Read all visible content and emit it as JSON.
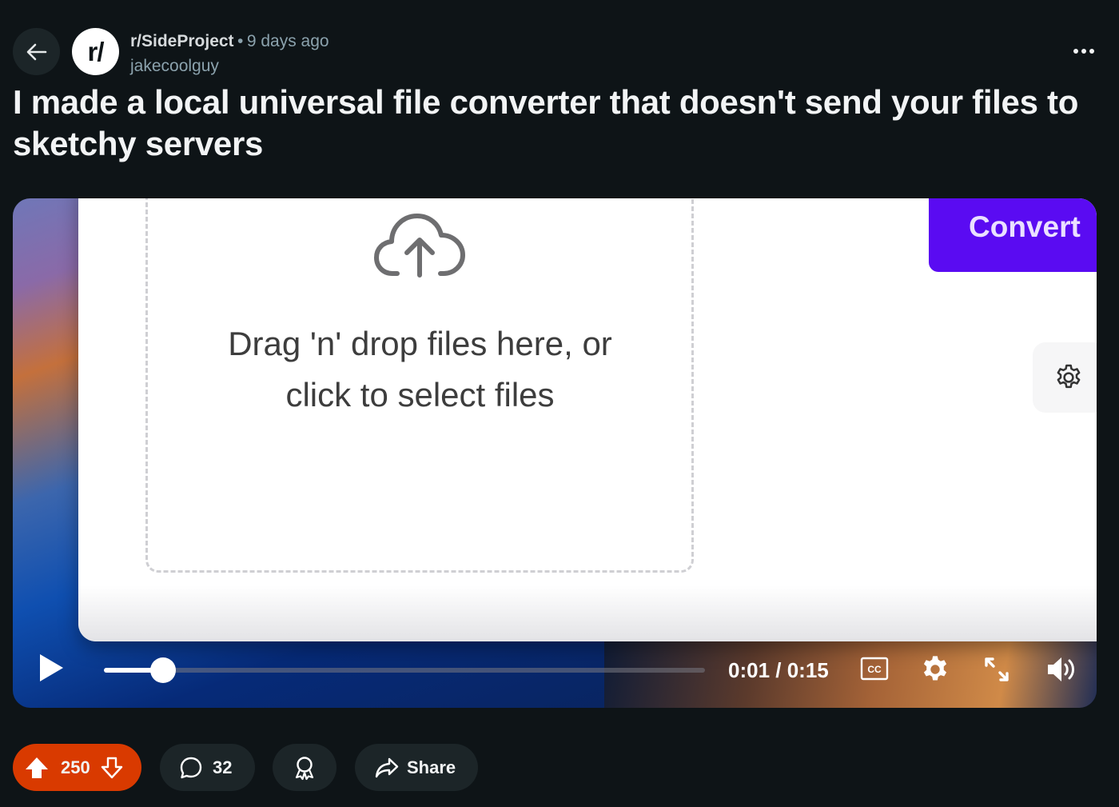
{
  "post": {
    "subreddit": "r/SideProject",
    "subreddit_avatar": "r/",
    "separator": "•",
    "age": "9 days ago",
    "author": "jakecoolguy",
    "title": "I made a local universal file converter that doesn't send your files to sketchy servers"
  },
  "video": {
    "dropzone_line1": "Drag 'n' drop files here, or",
    "dropzone_line2": "click to select files",
    "convert_label": "Convert",
    "timecode": "0:01 / 0:15",
    "progress": 0.099,
    "accent_color": "#5a0bf2"
  },
  "actions": {
    "score": "250",
    "comments": "32",
    "share_label": "Share",
    "vote_color": "#d93a00"
  },
  "icons": [
    "back-arrow-icon",
    "more-options-icon",
    "cloud-upload-icon",
    "arrow-right-icon",
    "gear-icon",
    "play-icon",
    "closed-captions-icon",
    "settings-icon",
    "fullscreen-icon",
    "volume-icon",
    "upvote-icon",
    "downvote-icon",
    "comment-icon",
    "award-icon",
    "share-icon"
  ]
}
